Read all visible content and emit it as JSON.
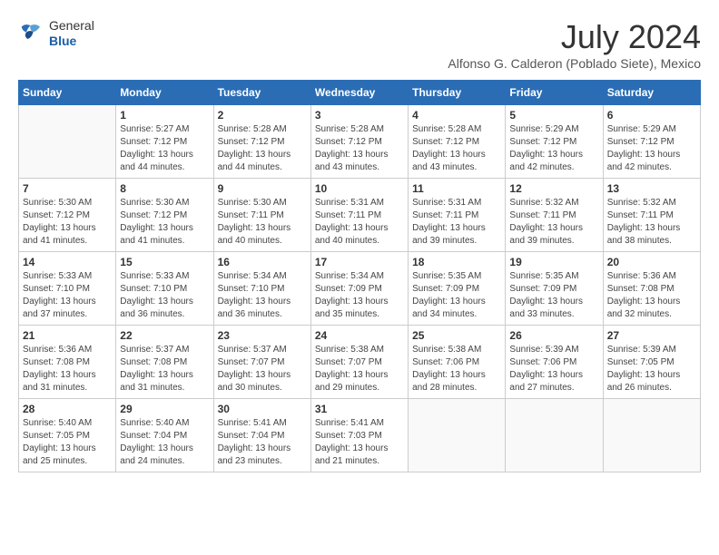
{
  "header": {
    "logo": {
      "general": "General",
      "blue": "Blue"
    },
    "title": "July 2024",
    "subtitle": "Alfonso G. Calderon (Poblado Siete), Mexico"
  },
  "calendar": {
    "weekdays": [
      "Sunday",
      "Monday",
      "Tuesday",
      "Wednesday",
      "Thursday",
      "Friday",
      "Saturday"
    ],
    "weeks": [
      [
        {
          "day": "",
          "sunrise": "",
          "sunset": "",
          "daylight": ""
        },
        {
          "day": "1",
          "sunrise": "Sunrise: 5:27 AM",
          "sunset": "Sunset: 7:12 PM",
          "daylight": "Daylight: 13 hours and 44 minutes."
        },
        {
          "day": "2",
          "sunrise": "Sunrise: 5:28 AM",
          "sunset": "Sunset: 7:12 PM",
          "daylight": "Daylight: 13 hours and 44 minutes."
        },
        {
          "day": "3",
          "sunrise": "Sunrise: 5:28 AM",
          "sunset": "Sunset: 7:12 PM",
          "daylight": "Daylight: 13 hours and 43 minutes."
        },
        {
          "day": "4",
          "sunrise": "Sunrise: 5:28 AM",
          "sunset": "Sunset: 7:12 PM",
          "daylight": "Daylight: 13 hours and 43 minutes."
        },
        {
          "day": "5",
          "sunrise": "Sunrise: 5:29 AM",
          "sunset": "Sunset: 7:12 PM",
          "daylight": "Daylight: 13 hours and 42 minutes."
        },
        {
          "day": "6",
          "sunrise": "Sunrise: 5:29 AM",
          "sunset": "Sunset: 7:12 PM",
          "daylight": "Daylight: 13 hours and 42 minutes."
        }
      ],
      [
        {
          "day": "7",
          "sunrise": "Sunrise: 5:30 AM",
          "sunset": "Sunset: 7:12 PM",
          "daylight": "Daylight: 13 hours and 41 minutes."
        },
        {
          "day": "8",
          "sunrise": "Sunrise: 5:30 AM",
          "sunset": "Sunset: 7:12 PM",
          "daylight": "Daylight: 13 hours and 41 minutes."
        },
        {
          "day": "9",
          "sunrise": "Sunrise: 5:30 AM",
          "sunset": "Sunset: 7:11 PM",
          "daylight": "Daylight: 13 hours and 40 minutes."
        },
        {
          "day": "10",
          "sunrise": "Sunrise: 5:31 AM",
          "sunset": "Sunset: 7:11 PM",
          "daylight": "Daylight: 13 hours and 40 minutes."
        },
        {
          "day": "11",
          "sunrise": "Sunrise: 5:31 AM",
          "sunset": "Sunset: 7:11 PM",
          "daylight": "Daylight: 13 hours and 39 minutes."
        },
        {
          "day": "12",
          "sunrise": "Sunrise: 5:32 AM",
          "sunset": "Sunset: 7:11 PM",
          "daylight": "Daylight: 13 hours and 39 minutes."
        },
        {
          "day": "13",
          "sunrise": "Sunrise: 5:32 AM",
          "sunset": "Sunset: 7:11 PM",
          "daylight": "Daylight: 13 hours and 38 minutes."
        }
      ],
      [
        {
          "day": "14",
          "sunrise": "Sunrise: 5:33 AM",
          "sunset": "Sunset: 7:10 PM",
          "daylight": "Daylight: 13 hours and 37 minutes."
        },
        {
          "day": "15",
          "sunrise": "Sunrise: 5:33 AM",
          "sunset": "Sunset: 7:10 PM",
          "daylight": "Daylight: 13 hours and 36 minutes."
        },
        {
          "day": "16",
          "sunrise": "Sunrise: 5:34 AM",
          "sunset": "Sunset: 7:10 PM",
          "daylight": "Daylight: 13 hours and 36 minutes."
        },
        {
          "day": "17",
          "sunrise": "Sunrise: 5:34 AM",
          "sunset": "Sunset: 7:09 PM",
          "daylight": "Daylight: 13 hours and 35 minutes."
        },
        {
          "day": "18",
          "sunrise": "Sunrise: 5:35 AM",
          "sunset": "Sunset: 7:09 PM",
          "daylight": "Daylight: 13 hours and 34 minutes."
        },
        {
          "day": "19",
          "sunrise": "Sunrise: 5:35 AM",
          "sunset": "Sunset: 7:09 PM",
          "daylight": "Daylight: 13 hours and 33 minutes."
        },
        {
          "day": "20",
          "sunrise": "Sunrise: 5:36 AM",
          "sunset": "Sunset: 7:08 PM",
          "daylight": "Daylight: 13 hours and 32 minutes."
        }
      ],
      [
        {
          "day": "21",
          "sunrise": "Sunrise: 5:36 AM",
          "sunset": "Sunset: 7:08 PM",
          "daylight": "Daylight: 13 hours and 31 minutes."
        },
        {
          "day": "22",
          "sunrise": "Sunrise: 5:37 AM",
          "sunset": "Sunset: 7:08 PM",
          "daylight": "Daylight: 13 hours and 31 minutes."
        },
        {
          "day": "23",
          "sunrise": "Sunrise: 5:37 AM",
          "sunset": "Sunset: 7:07 PM",
          "daylight": "Daylight: 13 hours and 30 minutes."
        },
        {
          "day": "24",
          "sunrise": "Sunrise: 5:38 AM",
          "sunset": "Sunset: 7:07 PM",
          "daylight": "Daylight: 13 hours and 29 minutes."
        },
        {
          "day": "25",
          "sunrise": "Sunrise: 5:38 AM",
          "sunset": "Sunset: 7:06 PM",
          "daylight": "Daylight: 13 hours and 28 minutes."
        },
        {
          "day": "26",
          "sunrise": "Sunrise: 5:39 AM",
          "sunset": "Sunset: 7:06 PM",
          "daylight": "Daylight: 13 hours and 27 minutes."
        },
        {
          "day": "27",
          "sunrise": "Sunrise: 5:39 AM",
          "sunset": "Sunset: 7:05 PM",
          "daylight": "Daylight: 13 hours and 26 minutes."
        }
      ],
      [
        {
          "day": "28",
          "sunrise": "Sunrise: 5:40 AM",
          "sunset": "Sunset: 7:05 PM",
          "daylight": "Daylight: 13 hours and 25 minutes."
        },
        {
          "day": "29",
          "sunrise": "Sunrise: 5:40 AM",
          "sunset": "Sunset: 7:04 PM",
          "daylight": "Daylight: 13 hours and 24 minutes."
        },
        {
          "day": "30",
          "sunrise": "Sunrise: 5:41 AM",
          "sunset": "Sunset: 7:04 PM",
          "daylight": "Daylight: 13 hours and 23 minutes."
        },
        {
          "day": "31",
          "sunrise": "Sunrise: 5:41 AM",
          "sunset": "Sunset: 7:03 PM",
          "daylight": "Daylight: 13 hours and 21 minutes."
        },
        {
          "day": "",
          "sunrise": "",
          "sunset": "",
          "daylight": ""
        },
        {
          "day": "",
          "sunrise": "",
          "sunset": "",
          "daylight": ""
        },
        {
          "day": "",
          "sunrise": "",
          "sunset": "",
          "daylight": ""
        }
      ]
    ]
  }
}
